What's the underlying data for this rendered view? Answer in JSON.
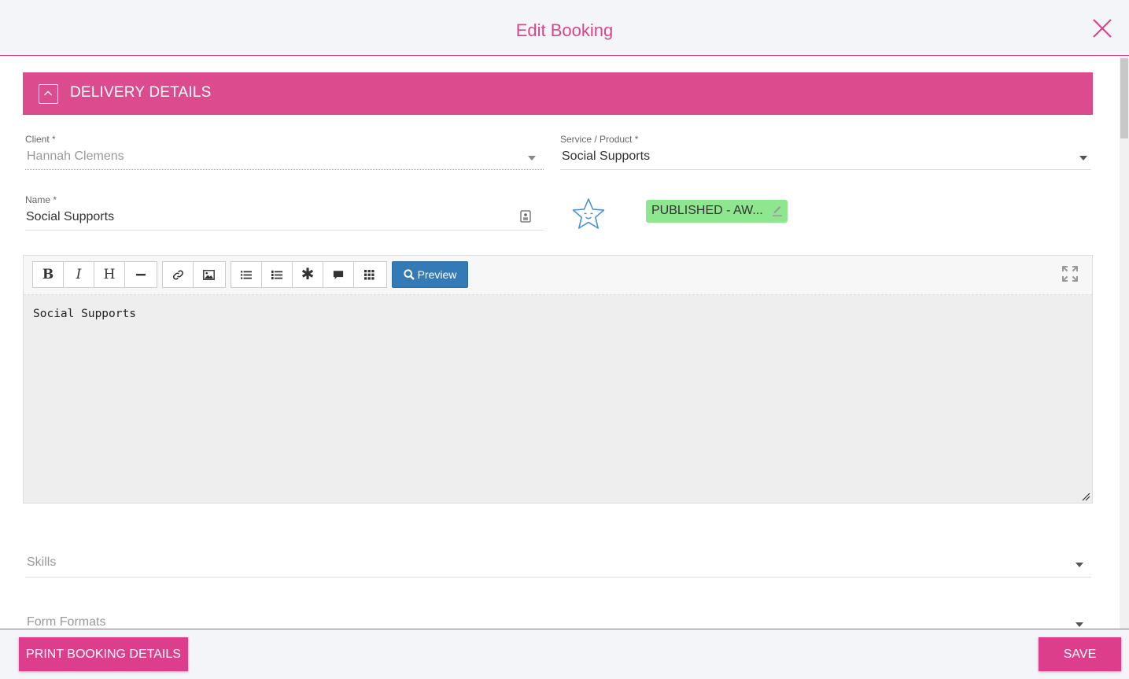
{
  "header": {
    "title": "Edit Booking"
  },
  "section": {
    "title": "DELIVERY DETAILS"
  },
  "fields": {
    "client": {
      "label": "Client *",
      "value": "Hannah Clemens"
    },
    "service": {
      "label": "Service / Product *",
      "value": "Social Supports"
    },
    "name": {
      "label": "Name *",
      "value": "Social Supports"
    },
    "skills": {
      "placeholder": "Skills"
    },
    "form_formats": {
      "placeholder": "Form Formats"
    }
  },
  "status": {
    "label": "PUBLISHED - AW..."
  },
  "editor": {
    "preview_label": "Preview",
    "content": "Social Supports"
  },
  "footer": {
    "print_label": "PRINT BOOKING DETAILS",
    "save_label": "SAVE"
  },
  "colors": {
    "accent": "#dd4b8f",
    "status_green": "#8ee68e",
    "preview_blue": "#337ab7"
  },
  "icons": [
    "close-icon",
    "chevron-up-icon",
    "id-card-icon",
    "star-face-icon",
    "edit-icon",
    "bold-icon",
    "italic-icon",
    "heading-icon",
    "horizontal-rule-icon",
    "link-icon",
    "image-icon",
    "unordered-list-icon",
    "ordered-list-icon",
    "asterisk-icon",
    "comment-icon",
    "table-icon",
    "search-icon",
    "fullscreen-icon",
    "resize-icon"
  ]
}
